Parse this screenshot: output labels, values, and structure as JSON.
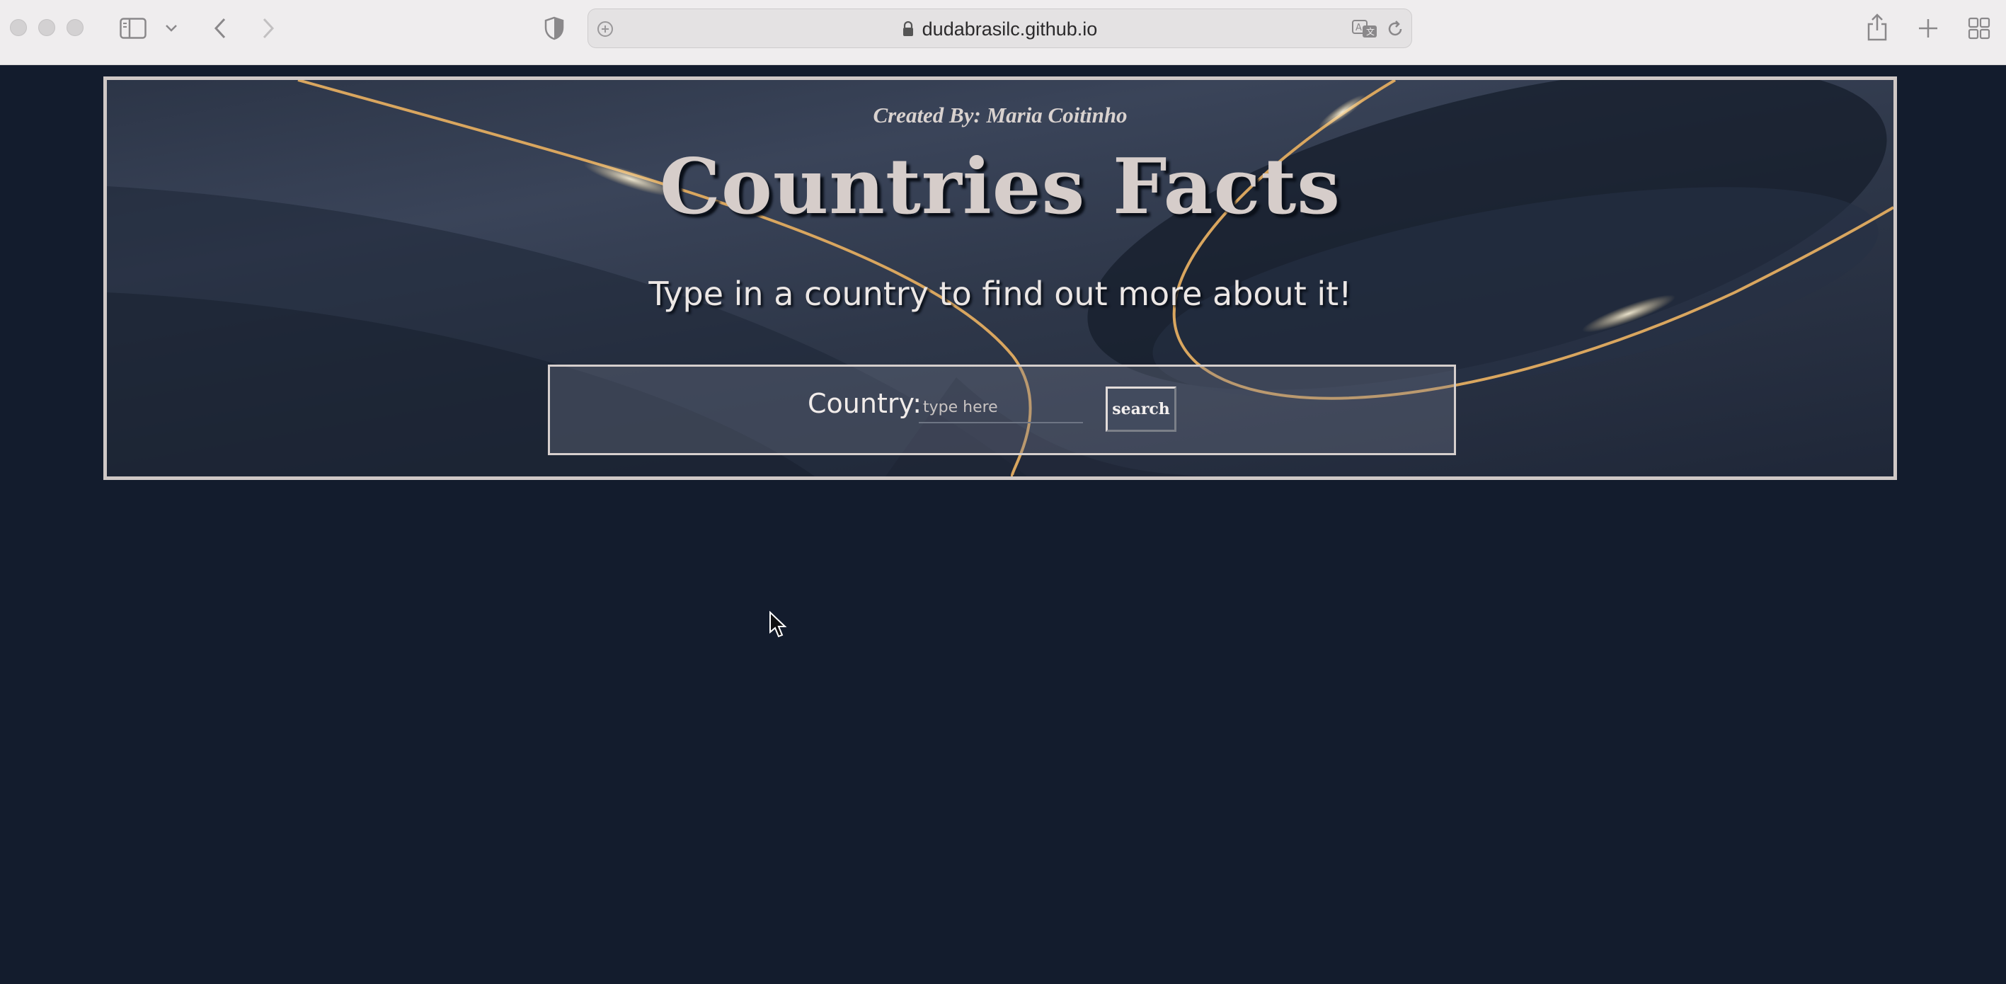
{
  "browser": {
    "url": "dudabrasilc.github.io",
    "icons": [
      "sidebar-icon",
      "chevron-down-icon",
      "back-icon",
      "forward-icon",
      "privacy-shield-icon",
      "site-settings-icon",
      "lock-icon",
      "translate-icon",
      "reload-icon",
      "share-icon",
      "new-tab-icon",
      "tab-overview-icon"
    ]
  },
  "page": {
    "creator": "Created By: Maria Coitinho",
    "title": "Countries Facts",
    "subtitle": "Type in a country to find out more about it!",
    "search": {
      "label": "Country:",
      "placeholder": "type here",
      "value": "",
      "button_label": "search"
    }
  },
  "colors": {
    "page_background": "#131c2d",
    "frame_border": "#cfc8c6",
    "gold_accent": "#d9a65f",
    "title_text": "#d6cdca"
  }
}
